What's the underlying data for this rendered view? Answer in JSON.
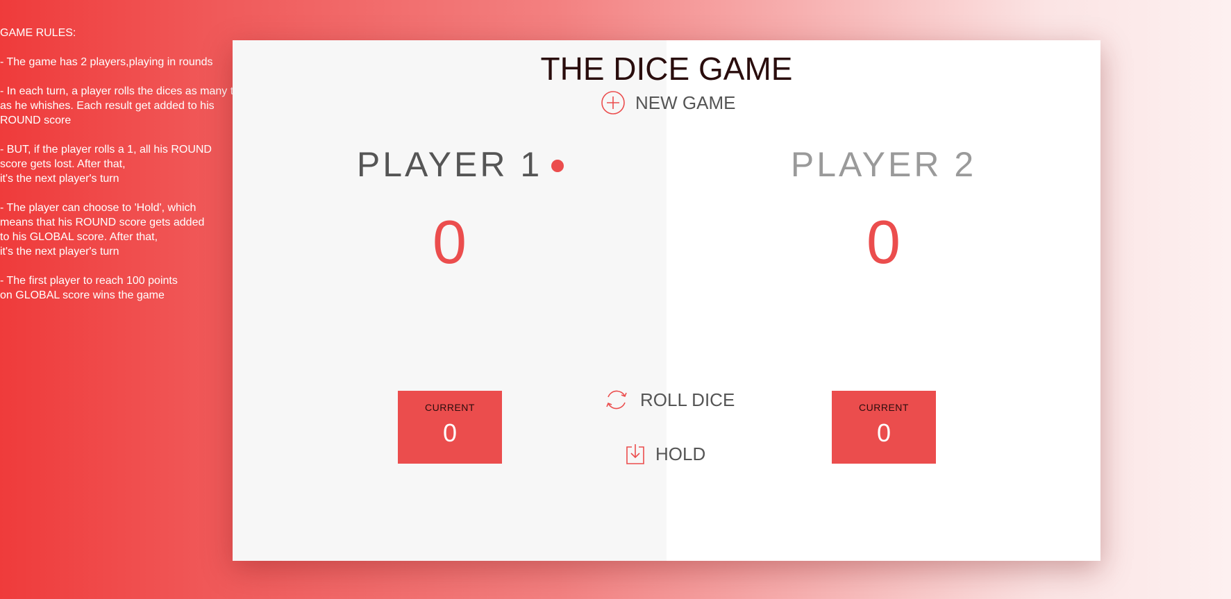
{
  "rules": {
    "title": "GAME RULES:",
    "blocks": [
      [
        "- The game has 2 players,playing in rounds"
      ],
      [
        "- In each turn, a player rolls the dices as many t",
        "as he whishes. Each result get added to his",
        "ROUND score"
      ],
      [
        "- BUT, if the player rolls a 1, all his ROUND",
        "score gets lost. After that,",
        "it's the next player's turn"
      ],
      [
        "- The player can choose to 'Hold', which",
        "means that his ROUND score gets added",
        "to his GLOBAL score. After that,",
        "it's the next player's turn"
      ],
      [
        "- The first player to reach 100 points",
        "on GLOBAL score wins the game"
      ]
    ]
  },
  "game": {
    "title": "THE DICE GAME",
    "new_game_label": "NEW GAME",
    "roll_dice_label": "ROLL DICE",
    "hold_label": "HOLD"
  },
  "players": [
    {
      "name": "PLAYER 1",
      "score": "0",
      "current_label": "CURRENT",
      "current_score": "0",
      "active": true
    },
    {
      "name": "PLAYER 2",
      "score": "0",
      "current_label": "CURRENT",
      "current_score": "0",
      "active": false
    }
  ],
  "colors": {
    "accent": "#eb4d4d",
    "title_text": "#2a0d0d",
    "panel_left": "#f7f7f7",
    "panel_right": "#ffffff"
  },
  "icons": {
    "new_game": "add-circle-icon",
    "roll_dice": "refresh-icon",
    "hold": "download-icon",
    "active_player": "active-dot-icon"
  }
}
